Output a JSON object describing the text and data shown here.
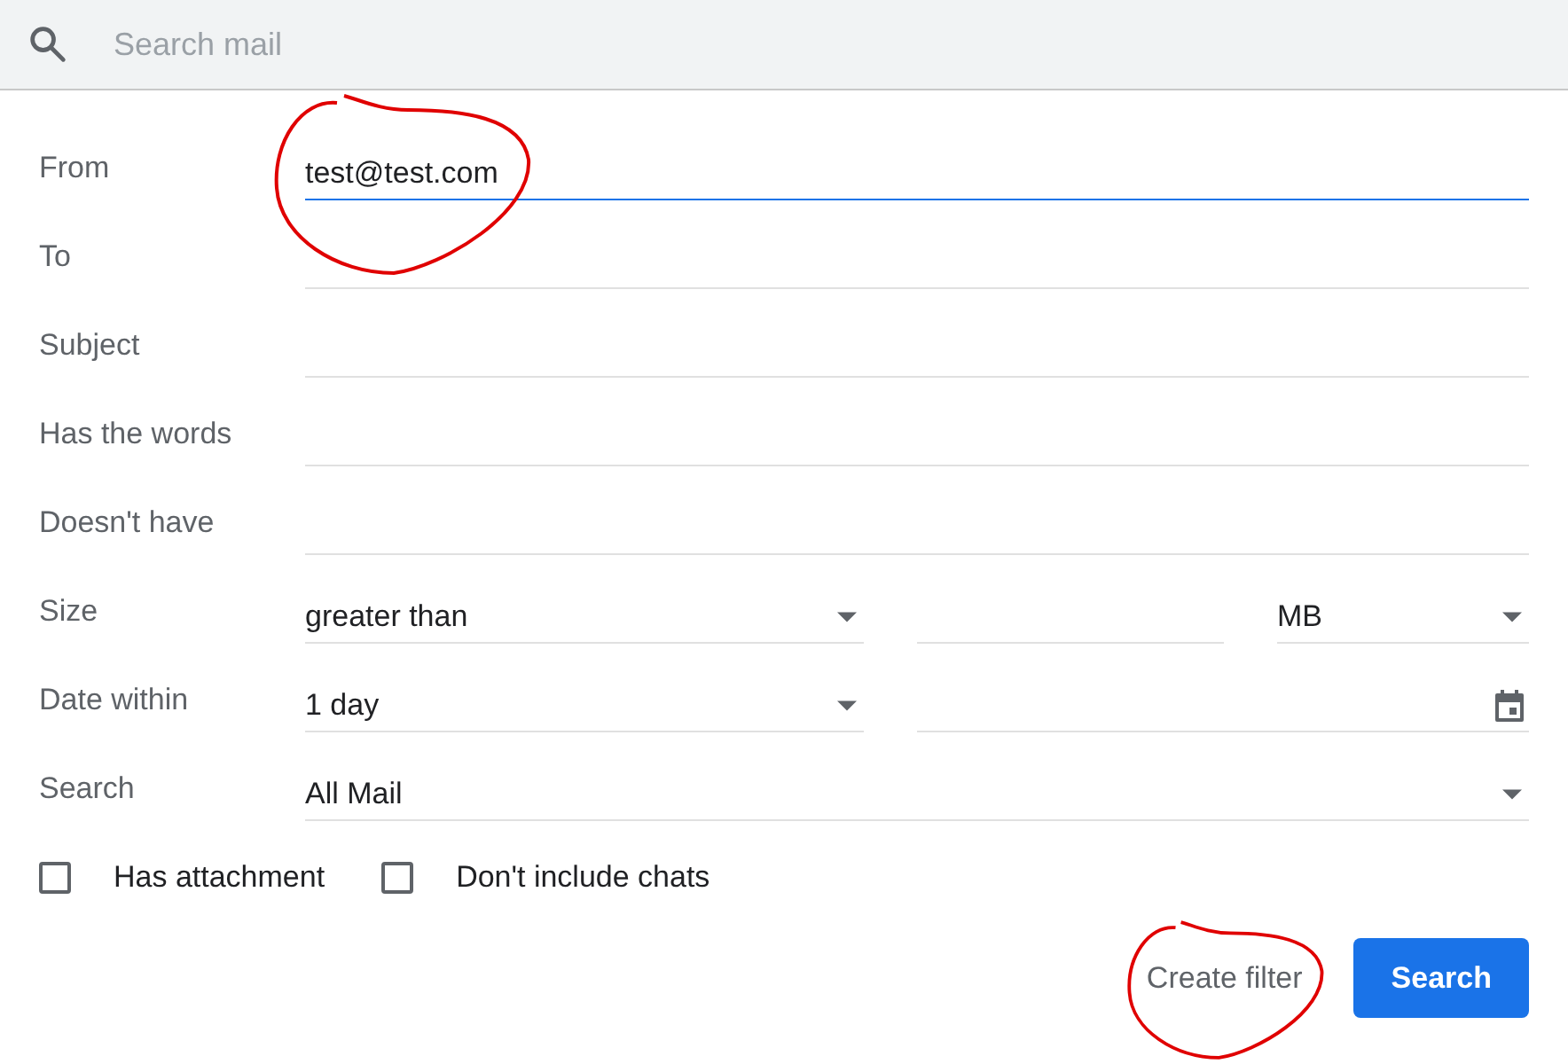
{
  "search": {
    "placeholder": "Search mail"
  },
  "rows": [
    {
      "kind": "text",
      "label": "From",
      "value": "test@test.com",
      "focused": true,
      "circled": true
    },
    {
      "kind": "text",
      "label": "To",
      "focused": false,
      "circled": false
    },
    {
      "kind": "text",
      "label": "Subject",
      "focused": false,
      "circled": false
    },
    {
      "kind": "text",
      "label": "Has the words",
      "focused": false,
      "circled": false
    },
    {
      "kind": "text",
      "label": "Doesn't have",
      "focused": false,
      "circled": false
    },
    {
      "kind": "size",
      "label": "Size",
      "operator": "greater than",
      "unit": "MB"
    },
    {
      "kind": "date",
      "label": "Date within",
      "period": "1 day"
    },
    {
      "kind": "select",
      "label": "Search",
      "value": "All Mail"
    }
  ],
  "checkboxes": [
    {
      "label": "Has attachment",
      "checked": false
    },
    {
      "label": "Don't include chats",
      "checked": false
    }
  ],
  "buttons": [
    {
      "label": "Create filter",
      "kind": "text",
      "circled": true
    },
    {
      "label": "Search",
      "kind": "primary",
      "circled": false
    }
  ]
}
